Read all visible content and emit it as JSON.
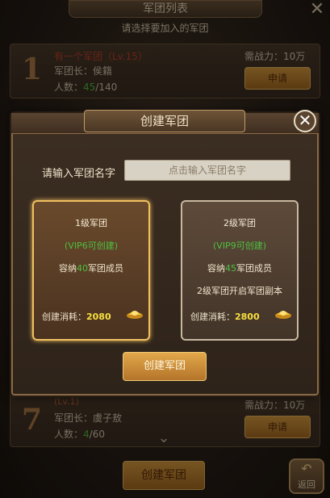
{
  "screen": {
    "title": "军团列表",
    "subtitle": "请选择要加入的军团",
    "close_glyph": "✕",
    "create_button": "创建军团",
    "back_button": "返回",
    "back_glyph": "↶",
    "down_glyph": "⌄"
  },
  "legion_rows": [
    {
      "rank": "1",
      "name": "有一个军团（Lv.15）",
      "leader_label": "军团长：",
      "leader": "侯籍",
      "count_label": "人数：",
      "count_current": "45",
      "count_max": "/140",
      "power_label": "需战力：",
      "power": "10万",
      "apply": "申请"
    },
    {
      "rank": "7",
      "name": "(Lv.1)",
      "leader_label": "军团长：",
      "leader": "虞子敖",
      "count_label": "人数：",
      "count_current": "4",
      "count_max": "/60",
      "power_label": "需战力：",
      "power": "10万",
      "apply": "申请"
    }
  ],
  "modal": {
    "title": "创建军团",
    "close_glyph": "✕",
    "name_label": "请输入军团名字",
    "name_placeholder": "点击输入军团名字",
    "create_button": "创建军团",
    "cards": [
      {
        "title": "1级军团",
        "requirement": "(VIP6可创建)",
        "capacity_prefix": "容纳",
        "capacity": "40",
        "capacity_suffix": "军团成员",
        "extra": "",
        "cost_label": "创建消耗：",
        "cost": "2080"
      },
      {
        "title": "2级军团",
        "requirement": "(VIP9可创建)",
        "capacity_prefix": "容纳",
        "capacity": "45",
        "capacity_suffix": "军团成员",
        "extra": "2级军团开启军团副本",
        "cost_label": "创建消耗：",
        "cost": "2800"
      }
    ],
    "currency_icon": "gold-ingot-icon"
  },
  "colors": {
    "accent_gold": "#f0c060",
    "green_text": "#4ec040",
    "cost_yellow": "#f8e040",
    "button_orange": "#d69a3e"
  }
}
